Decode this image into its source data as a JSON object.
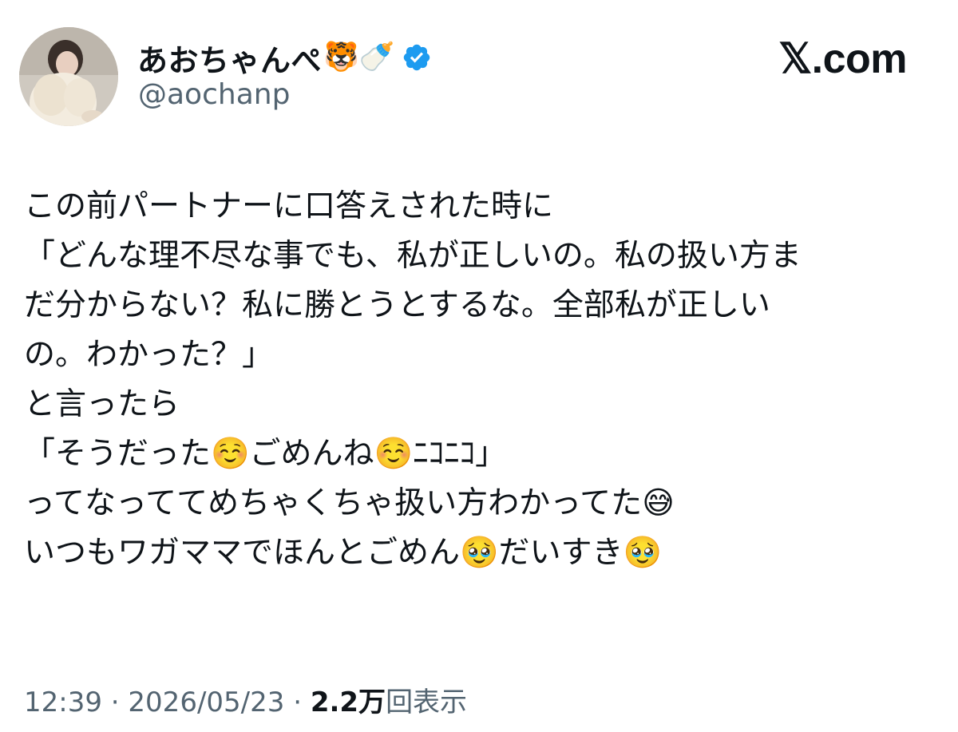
{
  "author": {
    "display_name": "あおちゃんぺ",
    "name_emojis": "🐯🍼",
    "handle": "@aochanp",
    "verified": true
  },
  "source_label": "𝕏.com",
  "tweet_lines": [
    "この前パートナーに口答えされた時に",
    "「どんな理不尽な事でも、私が正しいの。私の扱い方ま",
    "だ分からない？私に勝とうとするな。全部私が正しい",
    "の。わかった？」",
    "と言ったら",
    "「そうだった☺️ごめんね☺️ﾆｺﾆｺ」",
    "ってなっててめちゃくちゃ扱い方わかってた😅",
    "いつもワガママでほんとごめん🥹だいすき🥹"
  ],
  "meta": {
    "time": "12:39",
    "separator": " · ",
    "date": "2026/05/23",
    "views_count": "2.2万",
    "views_label": "回表示"
  },
  "colors": {
    "text": "#0f1419",
    "secondary": "#536471",
    "verified_badge": "#1d9bf0"
  },
  "icons": {
    "verified": "verified-badge-icon",
    "avatar": "avatar-photo"
  }
}
